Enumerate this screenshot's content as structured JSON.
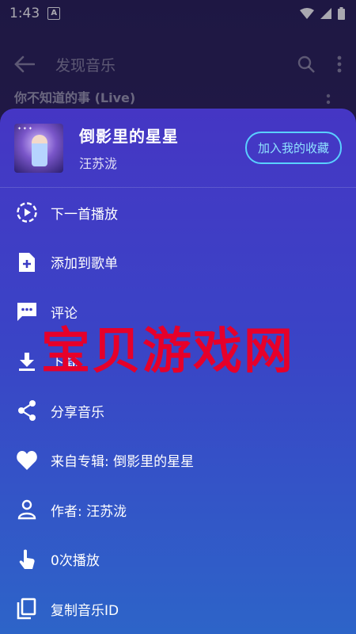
{
  "status_bar": {
    "time": "1:43",
    "notification_letter": "A"
  },
  "background_page": {
    "title": "发现音乐",
    "first_song": "你不知道的事 (Live)"
  },
  "sheet": {
    "song_title": "倒影里的星星",
    "artist": "汪苏泷",
    "favorite_button": "加入我的收藏",
    "menu": [
      {
        "icon": "play-next-icon",
        "label": "下一首播放"
      },
      {
        "icon": "add-to-playlist-icon",
        "label": "添加到歌单"
      },
      {
        "icon": "comment-icon",
        "label": "评论"
      },
      {
        "icon": "download-icon",
        "label": "下载"
      },
      {
        "icon": "share-icon",
        "label": "分享音乐"
      },
      {
        "icon": "album-icon",
        "label": "来自专辑: 倒影里的星星"
      },
      {
        "icon": "artist-icon",
        "label": "作者: 汪苏泷"
      },
      {
        "icon": "play-count-icon",
        "label": "0次播放"
      },
      {
        "icon": "copy-icon",
        "label": "复制音乐ID"
      }
    ]
  },
  "watermark": "宝贝游戏网",
  "colors": {
    "sheet_top": "#4536c4",
    "sheet_bottom": "#2d64c8",
    "accent": "#5ad0ff",
    "watermark": "#e6002a"
  }
}
